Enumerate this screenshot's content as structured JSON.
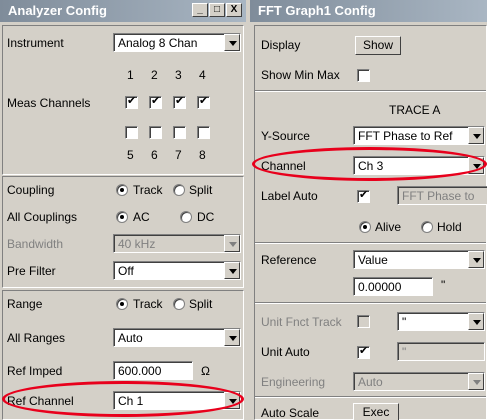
{
  "left": {
    "title": "Analyzer Config",
    "win": {
      "min": "_",
      "max": "□",
      "close": "X"
    },
    "instrument": {
      "label": "Instrument",
      "value": "Analog  8 Chan"
    },
    "meas_channels": {
      "label": "Meas Channels",
      "top_nums": [
        "1",
        "2",
        "3",
        "4"
      ],
      "bottom_nums": [
        "5",
        "6",
        "7",
        "8"
      ],
      "checked": [
        true,
        true,
        true,
        true,
        false,
        false,
        false,
        false
      ]
    },
    "coupling": {
      "label": "Coupling",
      "opt1": "Track",
      "opt2": "Split"
    },
    "all_couplings": {
      "label": "All Couplings",
      "opt1": "AC",
      "opt2": "DC"
    },
    "bandwidth": {
      "label": "Bandwidth",
      "value": "40 kHz"
    },
    "pre_filter": {
      "label": "Pre Filter",
      "value": "Off"
    },
    "range": {
      "label": "Range",
      "opt1": "Track",
      "opt2": "Split"
    },
    "all_ranges": {
      "label": "All Ranges",
      "value": "Auto"
    },
    "ref_imped": {
      "label": "Ref Imped",
      "value": "600.000",
      "unit": "Ω"
    },
    "ref_channel": {
      "label": "Ref Channel",
      "value": "Ch 1"
    }
  },
  "right": {
    "title": "FFT Graph1 Config",
    "display": {
      "label": "Display",
      "button": "Show"
    },
    "show_min_max": {
      "label": "Show Min Max"
    },
    "trace_header": "TRACE A",
    "y_source": {
      "label": "Y-Source",
      "value": "FFT Phase to Ref"
    },
    "channel": {
      "label": "Channel",
      "value": "Ch 3"
    },
    "label_auto": {
      "label": "Label Auto",
      "value": "FFT Phase to"
    },
    "alive_hold": {
      "opt1": "Alive",
      "opt2": "Hold"
    },
    "reference": {
      "label": "Reference",
      "value": "Value",
      "number": "0.00000",
      "unit": "\""
    },
    "unit_fnct_track": {
      "label": "Unit Fnct Track",
      "value": "\""
    },
    "unit_auto": {
      "label": "Unit Auto",
      "value": "\""
    },
    "engineering": {
      "label": "Engineering",
      "value": "Auto"
    },
    "auto_scale": {
      "label": "Auto Scale",
      "button": "Exec"
    }
  },
  "colors": {
    "highlight_ellipse": "#e8001c",
    "titlebar": "#8c98a5",
    "face": "#d4d0c8"
  }
}
